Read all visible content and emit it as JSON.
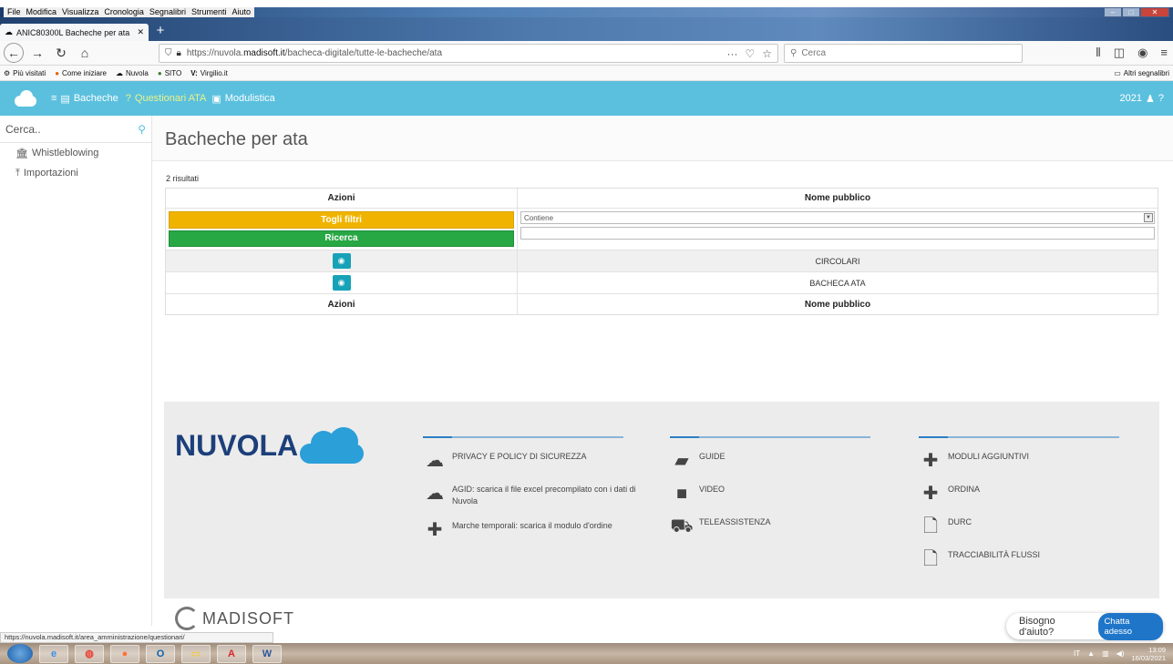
{
  "menubar": {
    "items": [
      "File",
      "Modifica",
      "Visualizza",
      "Cronologia",
      "Segnalibri",
      "Strumenti",
      "Aiuto"
    ]
  },
  "tab": {
    "title": "ANIC80300L Bacheche per ata",
    "close": "✕",
    "new": "+"
  },
  "nav": {
    "url_prefix": "https://nuvola.",
    "url_domain": "madisoft.it",
    "url_path": "/bacheca-digitale/tutte-le-bacheche/ata",
    "search_placeholder": "Cerca"
  },
  "bookmarks": {
    "items": [
      "Più visitati",
      "Come iniziare",
      "Nuvola",
      "SITO",
      "Virgilio.it"
    ],
    "other": "Altri segnalibri"
  },
  "appheader": {
    "bacheche": "Bacheche",
    "questionari": "Questionari ATA",
    "modulistica": "Modulistica",
    "year": "2021"
  },
  "sidebar": {
    "search_placeholder": "Cerca..",
    "items": [
      {
        "label": "Whistleblowing",
        "icon": "bank-icon"
      },
      {
        "label": "Importazioni",
        "icon": "upload-icon"
      }
    ]
  },
  "main": {
    "title": "Bacheche per ata",
    "results": "2 risultati",
    "columns": {
      "actions": "Azioni",
      "name": "Nome pubblico"
    },
    "filters": {
      "clear": "Togli filtri",
      "search": "Ricerca",
      "operator": "Contiene"
    },
    "rows": [
      {
        "name": "CIRCOLARI"
      },
      {
        "name": "BACHECA ATA"
      }
    ]
  },
  "footer": {
    "logo": "NUVOLA",
    "col1": [
      {
        "label": "PRIVACY E POLICY DI SICUREZZA",
        "icon": "cloud-download-icon"
      },
      {
        "label": "AGID: scarica il file excel precompilato con i dati di Nuvola",
        "icon": "cloud-download-icon"
      },
      {
        "label": "Marche temporali: scarica il modulo d'ordine",
        "icon": "plus-icon"
      }
    ],
    "col2": [
      {
        "label": "GUIDE",
        "icon": "book-icon"
      },
      {
        "label": "VIDEO",
        "icon": "video-camera-icon"
      },
      {
        "label": "TELEASSISTENZA",
        "icon": "ambulance-icon"
      }
    ],
    "col3": [
      {
        "label": "MODULI AGGIUNTIVI",
        "icon": "plus-icon"
      },
      {
        "label": "ORDINA",
        "icon": "plus-icon"
      },
      {
        "label": "DURC",
        "icon": "file-icon"
      },
      {
        "label": "TRACCIABILITÀ FLUSSI",
        "icon": "file-icon"
      }
    ],
    "madisoft": "MADISOFT"
  },
  "statusbar": {
    "url": "https://nuvola.madisoft.it/area_amministrazione/questionari/"
  },
  "chat": {
    "prompt": "Bisogno d'aiuto?",
    "button": "Chatta adesso"
  },
  "taskbar": {
    "lang": "IT",
    "time": "13:09",
    "date": "16/03/2021"
  }
}
